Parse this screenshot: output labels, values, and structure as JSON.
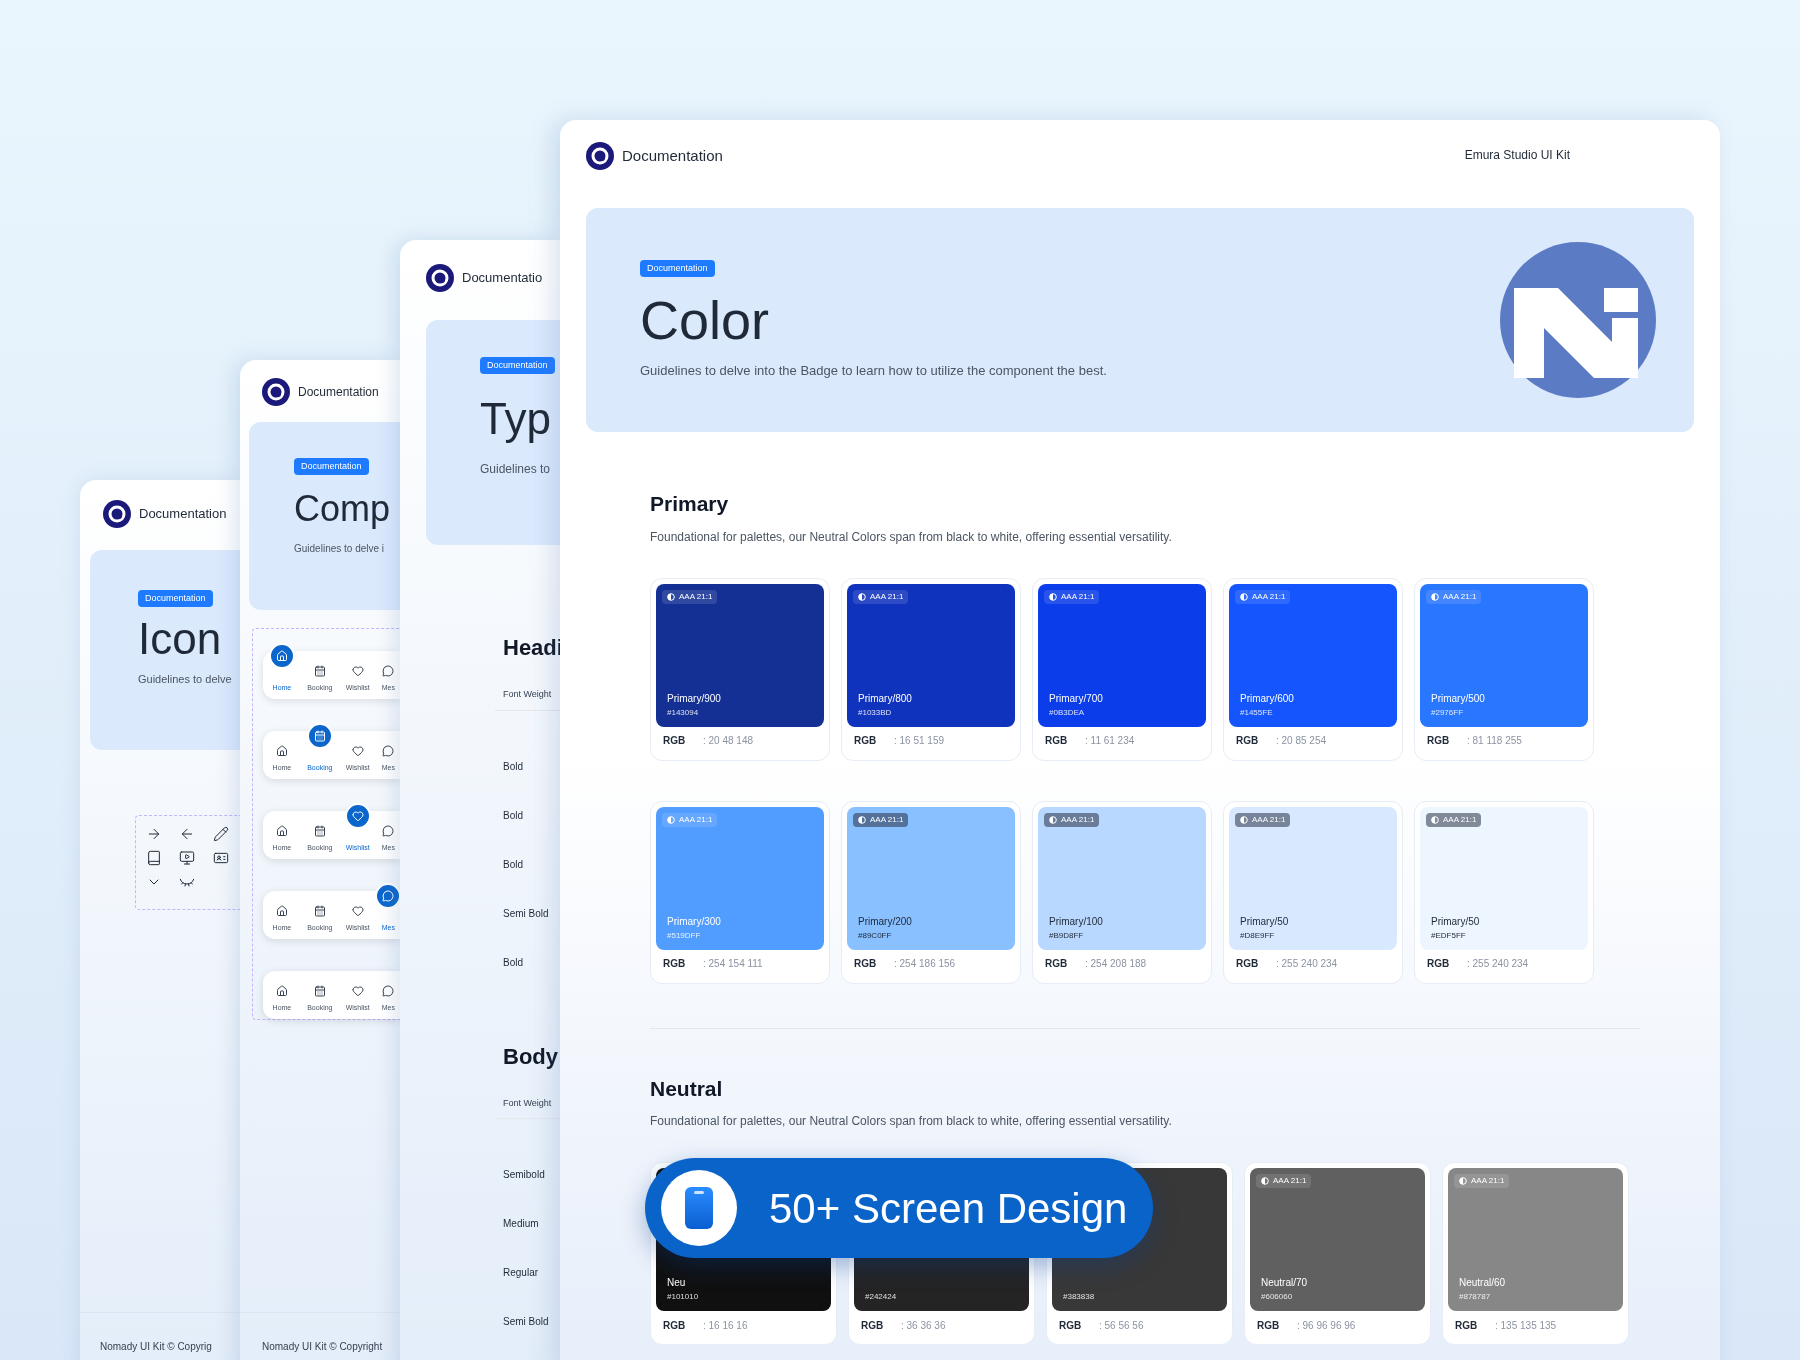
{
  "pages": [
    {
      "kind": "icon",
      "brand": "Documentation",
      "badge": "Documentation",
      "title": "Icon",
      "subtitle": "Guidelines to delve",
      "footer": "Nomady UI Kit © Copyrig"
    },
    {
      "kind": "component",
      "brand": "Documentation",
      "badge": "Documentation",
      "title": "Comp",
      "subtitle": "Guidelines to delve i",
      "footer": "Nomady UI Kit © Copyright",
      "nav_bars": [
        {
          "items": [
            {
              "label": "Home",
              "selected": true
            },
            {
              "label": "Booking",
              "selected": false
            },
            {
              "label": "Wishlist",
              "selected": false
            },
            {
              "label": "Mes",
              "selected": false
            }
          ]
        },
        {
          "items": [
            {
              "label": "Home",
              "selected": false
            },
            {
              "label": "Booking",
              "selected": true
            },
            {
              "label": "Wishlist",
              "selected": false
            },
            {
              "label": "Mes",
              "selected": false
            }
          ]
        },
        {
          "items": [
            {
              "label": "Home",
              "selected": false
            },
            {
              "label": "Booking",
              "selected": false
            },
            {
              "label": "Wishlist",
              "selected": true
            },
            {
              "label": "Mes",
              "selected": false
            }
          ]
        },
        {
          "items": [
            {
              "label": "Home",
              "selected": false
            },
            {
              "label": "Booking",
              "selected": false
            },
            {
              "label": "Wishlist",
              "selected": false
            },
            {
              "label": "Mes",
              "selected": true
            }
          ]
        },
        {
          "items": [
            {
              "label": "Home",
              "selected": false
            },
            {
              "label": "Booking",
              "selected": false
            },
            {
              "label": "Wishlist",
              "selected": false
            },
            {
              "label": "Mes",
              "selected": false
            }
          ]
        }
      ]
    },
    {
      "kind": "typography",
      "brand": "Documentatio",
      "badge": "Documentation",
      "title": "Typ",
      "subtitle": "Guidelines to",
      "sections": [
        {
          "title": "Headi",
          "column": "Font Weight",
          "rows": [
            "Bold",
            "Bold",
            "Bold",
            "Semi Bold",
            "Bold"
          ]
        },
        {
          "title": "Body",
          "column": "Font Weight",
          "rows": [
            "Semibold",
            "Medium",
            "Regular",
            "Semi Bold"
          ]
        }
      ]
    }
  ],
  "main": {
    "brand": "Documentation",
    "kit": "Emura Studio UI Kit",
    "badge": "Documentation",
    "title": "Color",
    "subtitle": "Guidelines to delve into the Badge to learn how to utilize the component the best.",
    "palettes": [
      {
        "title": "Primary",
        "description": "Foundational for palettes, our Neutral Colors span from black to white, offering essential versatility.",
        "swatches": [
          {
            "badge": "AAA 21:1",
            "name": "Primary/900",
            "hex": "#143094",
            "color": "#143094",
            "rgb_label": "RGB",
            "rgb": ": 20 48 148"
          },
          {
            "badge": "AAA 21:1",
            "name": "Primary/800",
            "hex": "#1033BD",
            "color": "#1033bd",
            "rgb_label": "RGB",
            "rgb": ": 16 51 159"
          },
          {
            "badge": "AAA 21:1",
            "name": "Primary/700",
            "hex": "#0B3DEA",
            "color": "#0b3dea",
            "rgb_label": "RGB",
            "rgb": ": 11 61 234"
          },
          {
            "badge": "AAA 21:1",
            "name": "Primary/600",
            "hex": "#1455FE",
            "color": "#1455fe",
            "rgb_label": "RGB",
            "rgb": ": 20 85 254"
          },
          {
            "badge": "AAA 21:1",
            "name": "Primary/500",
            "hex": "#2976FF",
            "color": "#2976ff",
            "rgb_label": "RGB",
            "rgb": ": 81 118 255"
          },
          {
            "badge": "AAA 21:1",
            "name": "Primary/300",
            "hex": "#519DFF",
            "color": "#519dff",
            "rgb_label": "RGB",
            "rgb": ": 254 154 111"
          },
          {
            "badge": "AAA 21:1",
            "name": "Primary/200",
            "hex": "#89C0FF",
            "color": "#89c0ff",
            "rgb_label": "RGB",
            "rgb": ": 254 186 156"
          },
          {
            "badge": "AAA 21:1",
            "name": "Primary/100",
            "hex": "#B9D8FF",
            "color": "#b9d8ff",
            "rgb_label": "RGB",
            "rgb": ": 254 208 188"
          },
          {
            "badge": "AAA 21:1",
            "name": "Primary/50",
            "hex": "#D8E9FF",
            "color": "#d8e9ff",
            "rgb_label": "RGB",
            "rgb": ": 255 240 234"
          },
          {
            "badge": "AAA 21:1",
            "name": "Primary/50",
            "hex": "#EDF5FF",
            "color": "#edf5ff",
            "rgb_label": "RGB",
            "rgb": ": 255 240 234"
          }
        ]
      },
      {
        "title": "Neutral",
        "description": "Foundational for palettes, our Neutral Colors span from black to white, offering essential versatility.",
        "swatches": [
          {
            "name": "Neu",
            "hex": "#101010",
            "color": "#101010",
            "rgb_label": "RGB",
            "rgb": ": 16 16 16"
          },
          {
            "hex": "#242424",
            "color": "#242424",
            "rgb_label": "RGB",
            "rgb": ": 36 36 36"
          },
          {
            "hex": "#383838",
            "color": "#383838",
            "rgb_label": "RGB",
            "rgb": ": 56 56 56"
          },
          {
            "badge": "AAA 21:1",
            "name": "Neutral/70",
            "hex": "#606060",
            "color": "#606060",
            "rgb_label": "RGB",
            "rgb": ": 96 96 96 96"
          },
          {
            "badge": "AAA 21:1",
            "name": "Neutral/60",
            "hex": "#878787",
            "color": "#878787",
            "rgb_label": "RGB",
            "rgb": ": 135 135 135"
          }
        ]
      }
    ]
  },
  "banner": {
    "text": "50+ Screen Design"
  }
}
